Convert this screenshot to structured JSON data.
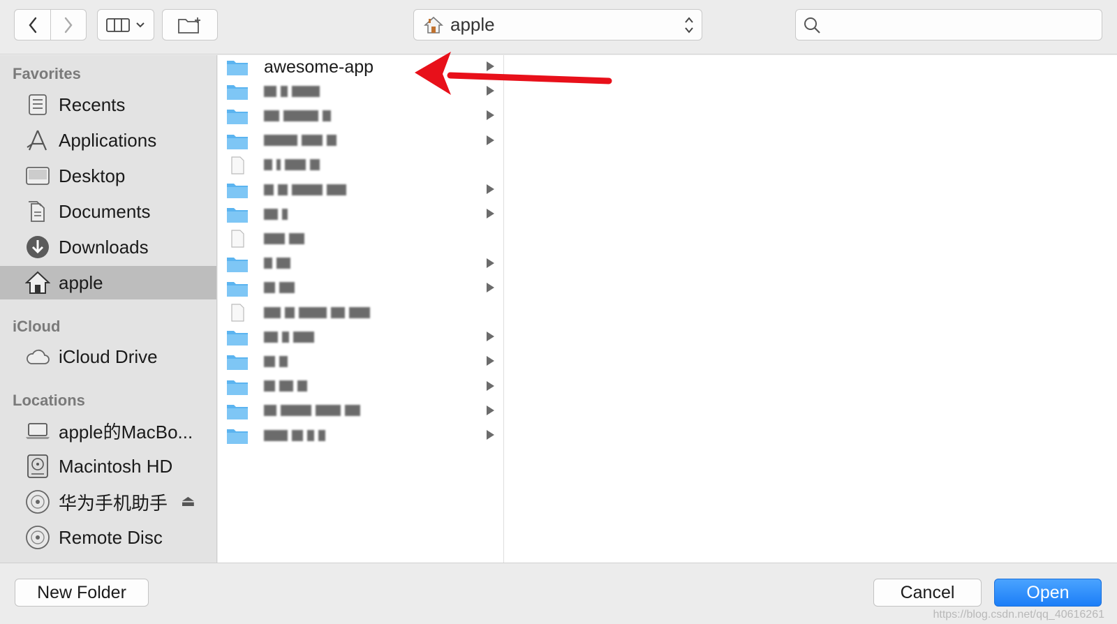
{
  "toolbar": {
    "path_label": "apple",
    "search_placeholder": ""
  },
  "sidebar": {
    "favorites_title": "Favorites",
    "favorites": [
      {
        "label": "Recents",
        "icon": "recents-icon"
      },
      {
        "label": "Applications",
        "icon": "applications-icon"
      },
      {
        "label": "Desktop",
        "icon": "desktop-icon"
      },
      {
        "label": "Documents",
        "icon": "documents-icon"
      },
      {
        "label": "Downloads",
        "icon": "downloads-icon"
      },
      {
        "label": "apple",
        "icon": "home-icon",
        "selected": true
      }
    ],
    "icloud_title": "iCloud",
    "icloud": [
      {
        "label": "iCloud Drive",
        "icon": "cloud-icon"
      }
    ],
    "locations_title": "Locations",
    "locations": [
      {
        "label": "apple的MacBo...",
        "icon": "laptop-icon"
      },
      {
        "label": "Macintosh HD",
        "icon": "harddrive-icon"
      },
      {
        "label": "华为手机助手",
        "icon": "disc-icon",
        "ejectable": true
      },
      {
        "label": "Remote Disc",
        "icon": "disc-icon"
      }
    ]
  },
  "browser": {
    "column1": [
      {
        "name": "awesome-app",
        "type": "folder",
        "has_children": true
      },
      {
        "name": "",
        "type": "folder",
        "has_children": true,
        "redacted": true
      },
      {
        "name": "",
        "type": "folder",
        "has_children": true,
        "redacted": true
      },
      {
        "name": "",
        "type": "folder",
        "has_children": true,
        "redacted": true
      },
      {
        "name": "",
        "type": "file",
        "has_children": false,
        "redacted": true
      },
      {
        "name": "",
        "type": "folder",
        "has_children": true,
        "redacted": true
      },
      {
        "name": "",
        "type": "folder",
        "has_children": true,
        "redacted": true
      },
      {
        "name": "",
        "type": "file",
        "has_children": false,
        "redacted": true
      },
      {
        "name": "",
        "type": "folder",
        "has_children": true,
        "redacted": true
      },
      {
        "name": "",
        "type": "folder",
        "has_children": true,
        "redacted": true
      },
      {
        "name": "",
        "type": "file",
        "has_children": false,
        "redacted": true
      },
      {
        "name": "",
        "type": "folder",
        "has_children": true,
        "redacted": true
      },
      {
        "name": "",
        "type": "folder",
        "has_children": true,
        "redacted": true
      },
      {
        "name": "",
        "type": "folder",
        "has_children": true,
        "redacted": true
      },
      {
        "name": "",
        "type": "folder",
        "has_children": true,
        "redacted": true
      },
      {
        "name": "",
        "type": "folder",
        "has_children": true,
        "redacted": true
      }
    ]
  },
  "bottom": {
    "new_folder_label": "New Folder",
    "cancel_label": "Cancel",
    "open_label": "Open",
    "watermark": "https://blog.csdn.net/qq_40616261"
  },
  "colors": {
    "accent": "#1c7ef7",
    "folder": "#5bb4f0",
    "annotation_arrow": "#e8101a",
    "selection": "#bdbdbd"
  }
}
